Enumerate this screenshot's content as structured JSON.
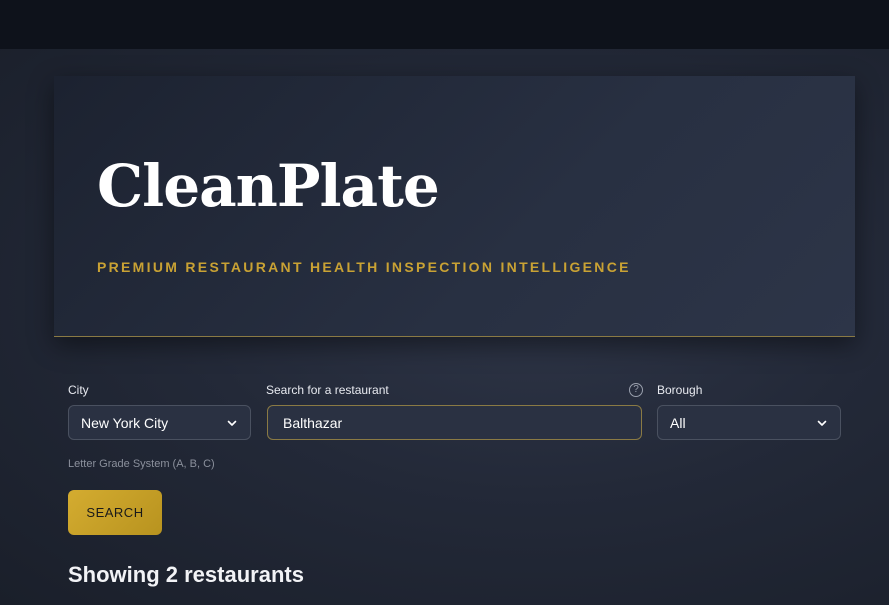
{
  "app": {
    "title": "CleanPlate",
    "subtitle": "PREMIUM RESTAURANT HEALTH INSPECTION INTELLIGENCE"
  },
  "filters": {
    "city": {
      "label": "City",
      "value": "New York City"
    },
    "search": {
      "label": "Search for a restaurant",
      "value": "Balthazar",
      "help_icon": "question-circle-icon"
    },
    "borough": {
      "label": "Borough",
      "value": "All"
    },
    "grade_hint": "Letter Grade System (A, B, C)"
  },
  "actions": {
    "search_label": "SEARCH"
  },
  "results": {
    "summary": "Showing 2 restaurants"
  },
  "colors": {
    "accent_gold": "#c9a234",
    "button_gold": "#d4ac30",
    "background": "#232938"
  }
}
